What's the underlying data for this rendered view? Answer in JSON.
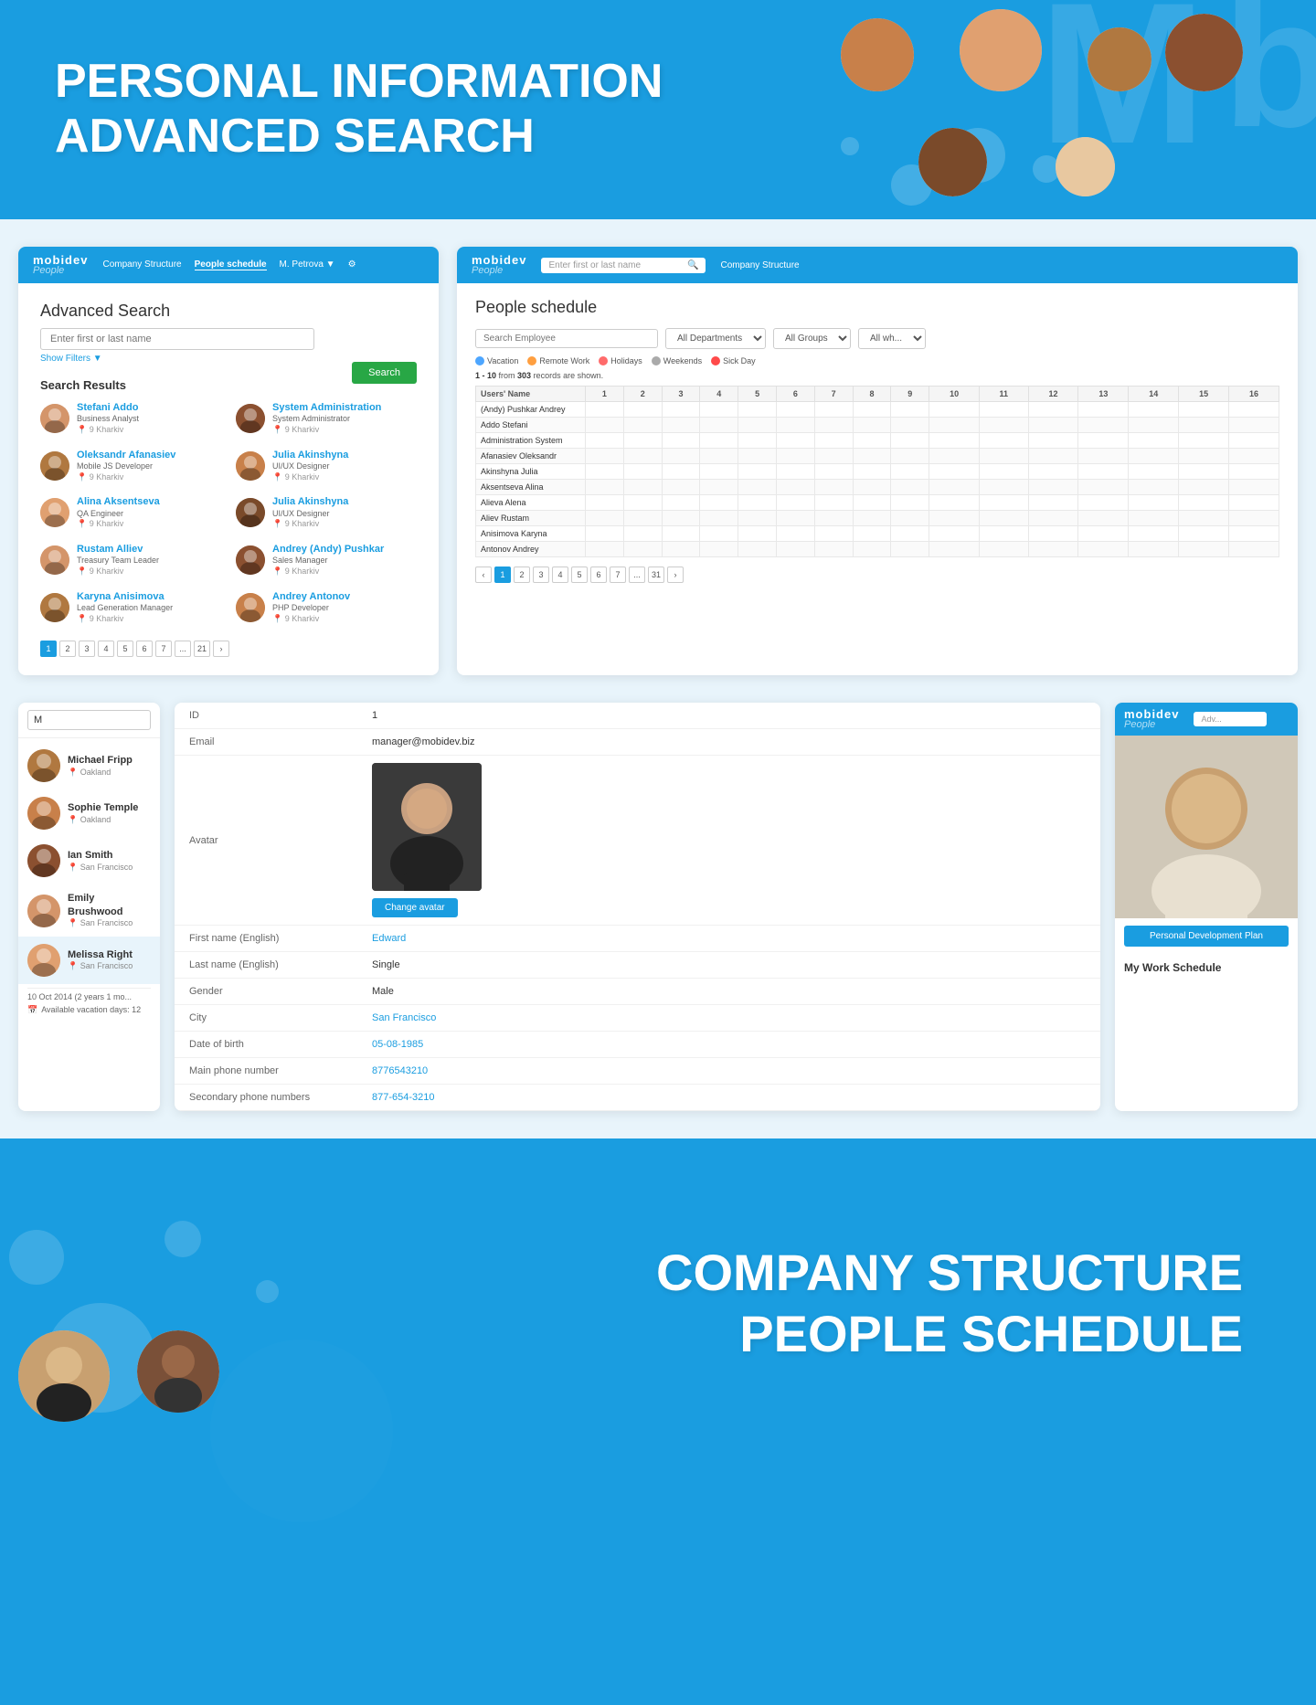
{
  "hero": {
    "line1": "PERSONAL INFORMATION",
    "line2": "ADVANCED SEARCH"
  },
  "brand": {
    "mobidev": "mobidev",
    "people": "People"
  },
  "advanced_search_panel": {
    "nav": [
      "Company Structure",
      "People schedule",
      "M. Petrova ▼",
      "⚙"
    ],
    "title": "Advanced Search",
    "input_placeholder": "Enter first or last name",
    "show_filters": "Show Filters ▼",
    "search_btn": "Search",
    "results_title": "Search Results",
    "results": [
      {
        "name": "Stefani Addo",
        "role": "Business Analyst",
        "loc": "9 Kharkiv"
      },
      {
        "name": "System Administration",
        "role": "System Administrator",
        "loc": "9 Kharkiv"
      },
      {
        "name": "Oleksandr Afanasiev",
        "role": "Mobile JS Developer",
        "loc": "9 Kharkiv"
      },
      {
        "name": "Julia Akinshyna",
        "role": "UI/UX Designer",
        "loc": "9 Kharkiv"
      },
      {
        "name": "Alina Aksentseva",
        "role": "QA Engineer",
        "loc": "9 Kharkiv"
      },
      {
        "name": "Julia Akinshyna",
        "role": "UI/UX Designer",
        "loc": "9 Kharkiv"
      },
      {
        "name": "Rustam Alliev",
        "role": "Treasury Team Leader",
        "loc": "9 Kharkiv"
      },
      {
        "name": "Andrey (Andy) Pushkar",
        "role": "Sales Manager",
        "loc": "9 Kharkiv"
      },
      {
        "name": "Karyna Anisimova",
        "role": "Lead Generation Manager",
        "loc": "9 Kharkiv"
      },
      {
        "name": "Andrey Antonov",
        "role": "PHP Developer",
        "loc": "9 Kharkiv"
      }
    ],
    "pagination": [
      "1",
      "2",
      "3",
      "4",
      "5",
      "6",
      "7",
      "...",
      "21",
      "›"
    ]
  },
  "people_schedule_panel": {
    "nav_search_placeholder": "Enter first or last name",
    "title": "People schedule",
    "search_placeholder": "Search Employee",
    "dept_options": [
      "All Departments"
    ],
    "group_options": [
      "All Groups"
    ],
    "legend": [
      {
        "label": "Vacation",
        "color": "#4da6ff"
      },
      {
        "label": "Remote Work",
        "color": "#ff9f40"
      },
      {
        "label": "Holidays",
        "color": "#ff6b6b"
      },
      {
        "label": "Weekends",
        "color": "#aaa"
      },
      {
        "label": "Sick Day",
        "color": "#ff4a4a"
      }
    ],
    "records_text": "1 - 10 from 303 records are shown.",
    "col_header": "Users' Name",
    "date_cols": [
      "1",
      "2",
      "3",
      "4",
      "5",
      "6",
      "7",
      "8",
      "9",
      "10",
      "11",
      "12",
      "13",
      "14",
      "15",
      "16"
    ],
    "rows": [
      "(Andy) Pushkar Andrey",
      "Addo Stefani",
      "Administration System",
      "Afanasiev Oleksandr",
      "Akinshyna Julia",
      "Aksentseva Alina",
      "Alieva Alena",
      "Aliev Rustam",
      "Anisimova Karyna",
      "Antonov Andrey"
    ],
    "pagination": [
      "‹",
      "1",
      "2",
      "3",
      "4",
      "5",
      "6",
      "7",
      "...",
      "31",
      "›"
    ]
  },
  "people_list": {
    "search_value": "M",
    "people": [
      {
        "name": "Michael Fripp",
        "city": "Oakland"
      },
      {
        "name": "Sophie Temple",
        "city": "Oakland"
      },
      {
        "name": "Ian Smith",
        "city": "San Francisco"
      },
      {
        "name": "Emily Brushwood",
        "city": "San Francisco"
      },
      {
        "name": "Melissa Right",
        "city": "San Francisco"
      }
    ],
    "date_label": "10 Oct 2014 (2 years 1 mo...",
    "vacation_label": "Available vacation days: 12"
  },
  "personal_info": {
    "fields": [
      {
        "label": "ID",
        "value": "1",
        "blue": false
      },
      {
        "label": "Email",
        "value": "manager@mobidev.biz",
        "blue": false
      },
      {
        "label": "First name (English)",
        "value": "Edward",
        "blue": true
      },
      {
        "label": "Last name (English)",
        "value": "Single",
        "blue": false
      },
      {
        "label": "Gender",
        "value": "Male",
        "blue": false
      },
      {
        "label": "City",
        "value": "San Francisco",
        "blue": true
      },
      {
        "label": "Date of birth",
        "value": "05-08-1985",
        "blue": true
      },
      {
        "label": "Main phone number",
        "value": "8776543210",
        "blue": true
      },
      {
        "label": "Secondary phone numbers",
        "value": "877-654-3210",
        "blue": true
      }
    ],
    "avatar_label": "Avatar",
    "change_avatar_btn": "Change avatar"
  },
  "right_panel": {
    "dev_plan_btn": "Personal Development Plan",
    "work_schedule_title": "My Work Schedule"
  },
  "bottom_hero": {
    "line1": "COMPANY STRUCTURE",
    "line2": "PEOPLE SCHEDULE"
  }
}
